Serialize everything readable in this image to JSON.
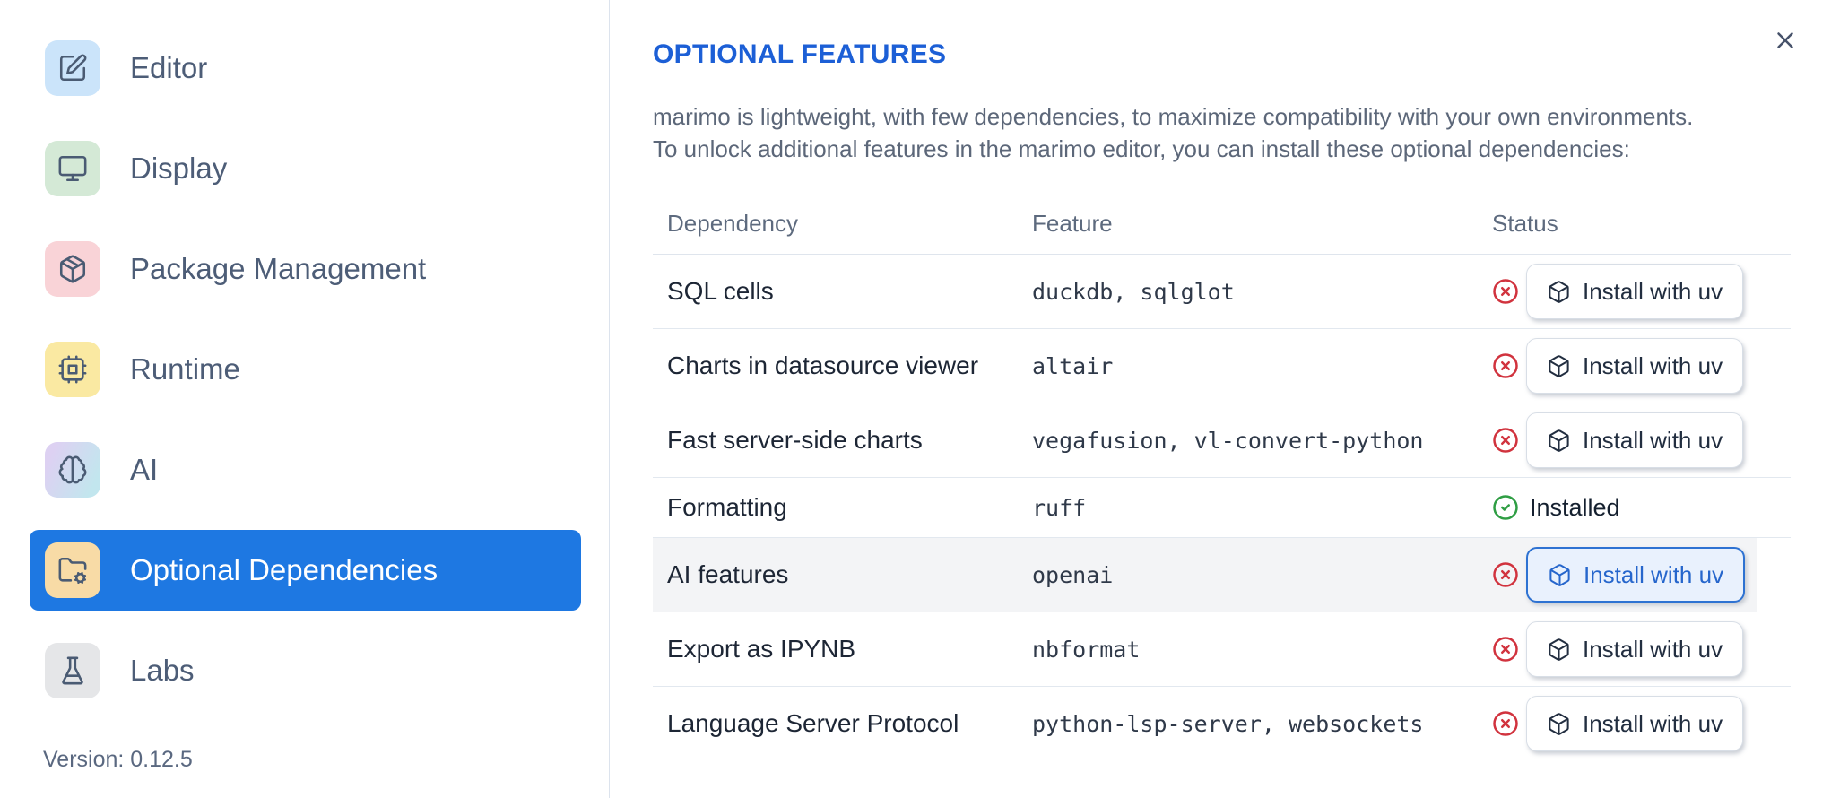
{
  "colors": {
    "accent_blue": "#1e78e2",
    "title_blue": "#1c5fd6",
    "link_blue": "#2666cc",
    "error_red": "#d1333e",
    "success_green": "#2f9e44",
    "row_highlight": "#f3f4f6"
  },
  "sidebar": {
    "items": [
      {
        "label": "Editor",
        "icon": "square-pen",
        "tile_color": "#cbe4fa",
        "selected": false
      },
      {
        "label": "Display",
        "icon": "monitor",
        "tile_color": "#d4e9d6",
        "selected": false
      },
      {
        "label": "Package Management",
        "icon": "package",
        "tile_color": "#f9d3d7",
        "selected": false
      },
      {
        "label": "Runtime",
        "icon": "cpu",
        "tile_color": "#fae9a2",
        "selected": false
      },
      {
        "label": "AI",
        "icon": "brain",
        "tile_color": "linear-gradient(115deg,#ddd1f2 15%,#c2e6ee 85%)",
        "selected": false
      },
      {
        "label": "Optional Dependencies",
        "icon": "folder-cog",
        "tile_color": "#f8dba6",
        "selected": true
      },
      {
        "label": "Labs",
        "icon": "flask",
        "tile_color": "#e5e6e8",
        "selected": false
      }
    ],
    "version_label": "Version: 0.12.5"
  },
  "panel": {
    "title": "OPTIONAL FEATURES",
    "close_icon": "x",
    "description_line1": "marimo is lightweight, with few dependencies, to maximize compatibility with your own environments.",
    "description_line2": "To unlock additional features in the marimo editor, you can install these optional dependencies:",
    "table": {
      "columns": [
        "Dependency",
        "Feature",
        "Status"
      ],
      "rows": [
        {
          "dependency": "SQL cells",
          "feature": "duckdb, sqlglot",
          "installed": false,
          "status_icon": "circle-x",
          "action": "Install with uv",
          "action_icon": "box",
          "highlighted": false
        },
        {
          "dependency": "Charts in datasource viewer",
          "feature": "altair",
          "installed": false,
          "status_icon": "circle-x",
          "action": "Install with uv",
          "action_icon": "box",
          "highlighted": false
        },
        {
          "dependency": "Fast server-side charts",
          "feature": "vegafusion, vl-convert-python",
          "installed": false,
          "status_icon": "circle-x",
          "action": "Install with uv",
          "action_icon": "box",
          "highlighted": false
        },
        {
          "dependency": "Formatting",
          "feature": "ruff",
          "installed": true,
          "status_icon": "circle-check",
          "status_label": "Installed",
          "highlighted": false
        },
        {
          "dependency": "AI features",
          "feature": "openai",
          "installed": false,
          "status_icon": "circle-x",
          "action": "Install with uv",
          "action_icon": "box",
          "highlighted": true
        },
        {
          "dependency": "Export as IPYNB",
          "feature": "nbformat",
          "installed": false,
          "status_icon": "circle-x",
          "action": "Install with uv",
          "action_icon": "box",
          "highlighted": false
        },
        {
          "dependency": "Language Server Protocol",
          "feature": "python-lsp-server, websockets",
          "installed": false,
          "status_icon": "circle-x",
          "action": "Install with uv",
          "action_icon": "box",
          "highlighted": false
        }
      ]
    }
  }
}
